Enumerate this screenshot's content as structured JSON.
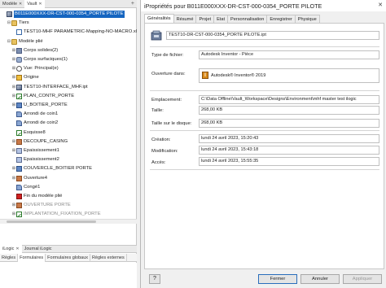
{
  "left_panel": {
    "tabs": [
      "Modèle",
      "Vault"
    ],
    "add": "+"
  },
  "tree": [
    {
      "label": "B011E000XXX-DR-CST-000-0354_PORTE PILOTE",
      "icon": "part-icon",
      "exp": "",
      "indent": 0,
      "selected": true
    },
    {
      "label": "Tiers",
      "icon": "folder-icon",
      "exp": "⊟",
      "indent": 1
    },
    {
      "label": "TEST10-MHF PARAMETRIC-Mapping-NO-MACRO.xlsx",
      "icon": "link-icon",
      "exp": "",
      "indent": 2
    },
    {
      "label": "Modèle plié",
      "icon": "folder-icon",
      "exp": "⊟",
      "indent": 1
    },
    {
      "label": "Corps solides(2)",
      "icon": "solid-icon",
      "exp": "⊞",
      "indent": 2
    },
    {
      "label": "Corps surfaciques(1)",
      "icon": "surface-icon",
      "exp": "⊞",
      "indent": 2
    },
    {
      "label": "Vue: Principal(e)",
      "icon": "eye-icon",
      "exp": "⊞",
      "indent": 2
    },
    {
      "label": "Origine",
      "icon": "origin-icon",
      "exp": "⊞",
      "indent": 2
    },
    {
      "label": "TEST10-INTERFACE_MHF.ipt",
      "icon": "part-icon",
      "exp": "⊞",
      "indent": 2
    },
    {
      "label": "PLAN_CONTR_PORTE",
      "icon": "sketch-icon",
      "exp": "⊞",
      "indent": 2
    },
    {
      "label": "U_BOITIER_PORTE",
      "icon": "feature-icon",
      "exp": "⊞",
      "indent": 2
    },
    {
      "label": "Arrondi de coin1",
      "icon": "fillet-icon",
      "exp": "",
      "indent": 2
    },
    {
      "label": "Arrondi de coin2",
      "icon": "fillet-icon",
      "exp": "",
      "indent": 2
    },
    {
      "label": "Esquisse8",
      "icon": "sketch-icon",
      "exp": "",
      "indent": 2
    },
    {
      "label": "DECOUPE_CASING",
      "icon": "cut-icon",
      "exp": "⊞",
      "indent": 2
    },
    {
      "label": "Epaississement1",
      "icon": "shell-icon",
      "exp": "⊞",
      "indent": 2
    },
    {
      "label": "Epaississement2",
      "icon": "shell-icon",
      "exp": "",
      "indent": 2
    },
    {
      "label": "COUVERCLE_BOITIER PORTE",
      "icon": "feature-icon",
      "exp": "⊞",
      "indent": 2
    },
    {
      "label": "Ouverture4",
      "icon": "cut-icon",
      "exp": "⊞",
      "indent": 2
    },
    {
      "label": "Congé1",
      "icon": "fillet-icon",
      "exp": "",
      "indent": 2
    },
    {
      "label": "Fin du modèle plié",
      "icon": "end-of-part-icon",
      "exp": "",
      "indent": 2
    },
    {
      "label": "OUVERTURE PORTE",
      "icon": "cut-icon",
      "exp": "⊞",
      "indent": 2,
      "dim": true
    },
    {
      "label": "IMPLANTATION_FIXATION_PORTE",
      "icon": "sketch-icon",
      "exp": "⊞",
      "indent": 2,
      "dim": true
    }
  ],
  "ilogic": {
    "tabs": [
      "iLogic",
      "Journal iLogic"
    ],
    "subtabs": [
      "Règles",
      "Formulaires",
      "Formulaires globaux",
      "Règles externes"
    ]
  },
  "dialog": {
    "title": "iPropriétés pour B011E000XXX-DR-CST-000-0354_PORTE PILOTE",
    "close": "✕",
    "tabs": [
      "Généralités",
      "Résumé",
      "Projet",
      "Etat",
      "Personnalisation",
      "Enregistrer",
      "Physique"
    ],
    "filename": "TEST10-DR-CST-000-0354_PORTE PILOTE.ipt",
    "fields": {
      "type_label": "Type de fichier:",
      "type_value": "Autodesk Inventor - Pièce",
      "open_label": "Ouverture dans:",
      "open_value": "Autodesk® Inventor® 2019",
      "location_label": "Emplacement:",
      "location_value": "C:\\Data Offline\\Vault_Workspace\\Designs\\Environment\\mhf master test ilogic",
      "size_label": "Taille:",
      "size_value": "268,00 KB",
      "disk_label": "Taille sur le disque:",
      "disk_value": "268,00 KB",
      "created_label": "Création:",
      "created_value": "lundi 24 avril 2023, 15:20:43",
      "modified_label": "Modification:",
      "modified_value": "lundi 24 avril 2023, 15:43:18",
      "access_label": "Accès:",
      "access_value": "lundi 24 avril 2023, 15:55:35"
    },
    "buttons": {
      "close": "Fermer",
      "cancel": "Annuler",
      "apply": "Appliquer"
    }
  }
}
